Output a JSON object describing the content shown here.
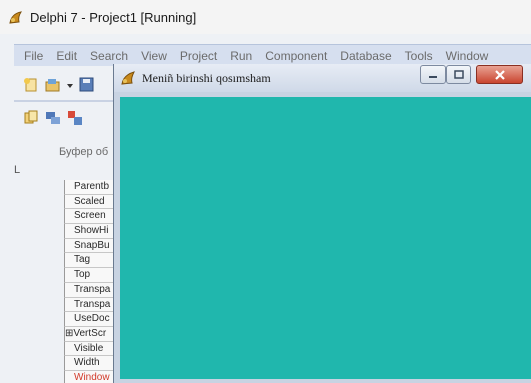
{
  "ide": {
    "title": "Delphi 7 - Project1 [Running]",
    "menu": [
      "File",
      "Edit",
      "Search",
      "View",
      "Project",
      "Run",
      "Component",
      "Database",
      "Tools",
      "Window"
    ]
  },
  "inspector": {
    "header": "Буфер об",
    "left_mark": "L",
    "properties": [
      {
        "label": "Parentb",
        "style": "normal"
      },
      {
        "label": "Scaled",
        "style": "normal"
      },
      {
        "label": "Screen",
        "style": "normal"
      },
      {
        "label": "ShowHi",
        "style": "normal"
      },
      {
        "label": "SnapBu",
        "style": "normal"
      },
      {
        "label": "Tag",
        "style": "normal"
      },
      {
        "label": "Top",
        "style": "normal"
      },
      {
        "label": "Transpa",
        "style": "normal"
      },
      {
        "label": "Transpa",
        "style": "normal"
      },
      {
        "label": "UseDoc",
        "style": "normal"
      },
      {
        "label": "⊞VertScr",
        "style": "expand"
      },
      {
        "label": "Visible",
        "style": "normal"
      },
      {
        "label": "Width",
        "style": "normal"
      },
      {
        "label": "Window",
        "style": "red"
      }
    ]
  },
  "form": {
    "title": "Meniñ birinshi qosımsham",
    "client_color": "#20b7ad"
  },
  "colors": {
    "menubar": "#d6dfef",
    "close_button": "#c9452f",
    "title_icon": "#c98a1d"
  }
}
